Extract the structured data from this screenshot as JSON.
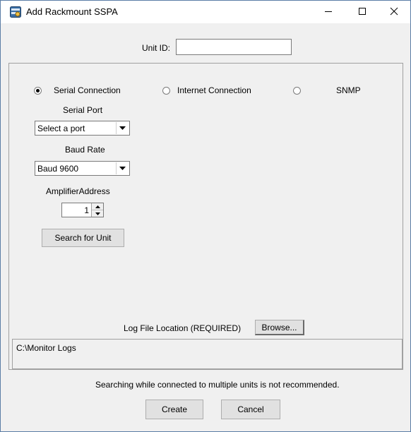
{
  "window": {
    "title": "Add Rackmount SSPA",
    "minimize_icon": "minimize-icon",
    "maximize_icon": "maximize-icon",
    "close_icon": "close-icon"
  },
  "unit_id": {
    "label": "Unit ID:",
    "value": ""
  },
  "connection": {
    "options": [
      {
        "label": "Serial Connection",
        "selected": true
      },
      {
        "label": "Internet Connection",
        "selected": false
      },
      {
        "label": "SNMP",
        "selected": false
      }
    ]
  },
  "serial": {
    "port_label": "Serial Port",
    "port_value": "Select a port",
    "baud_label": "Baud Rate",
    "baud_value": "Baud 9600",
    "address_label": "AmplifierAddress",
    "address_value": "1",
    "search_button": "Search for Unit"
  },
  "log": {
    "label": "Log File Location (REQUIRED)",
    "browse_button": "Browse...",
    "path": "C:\\Monitor Logs"
  },
  "footer": {
    "warning": "Searching while connected to multiple units is not recommended.",
    "create_button": "Create",
    "cancel_button": "Cancel"
  }
}
